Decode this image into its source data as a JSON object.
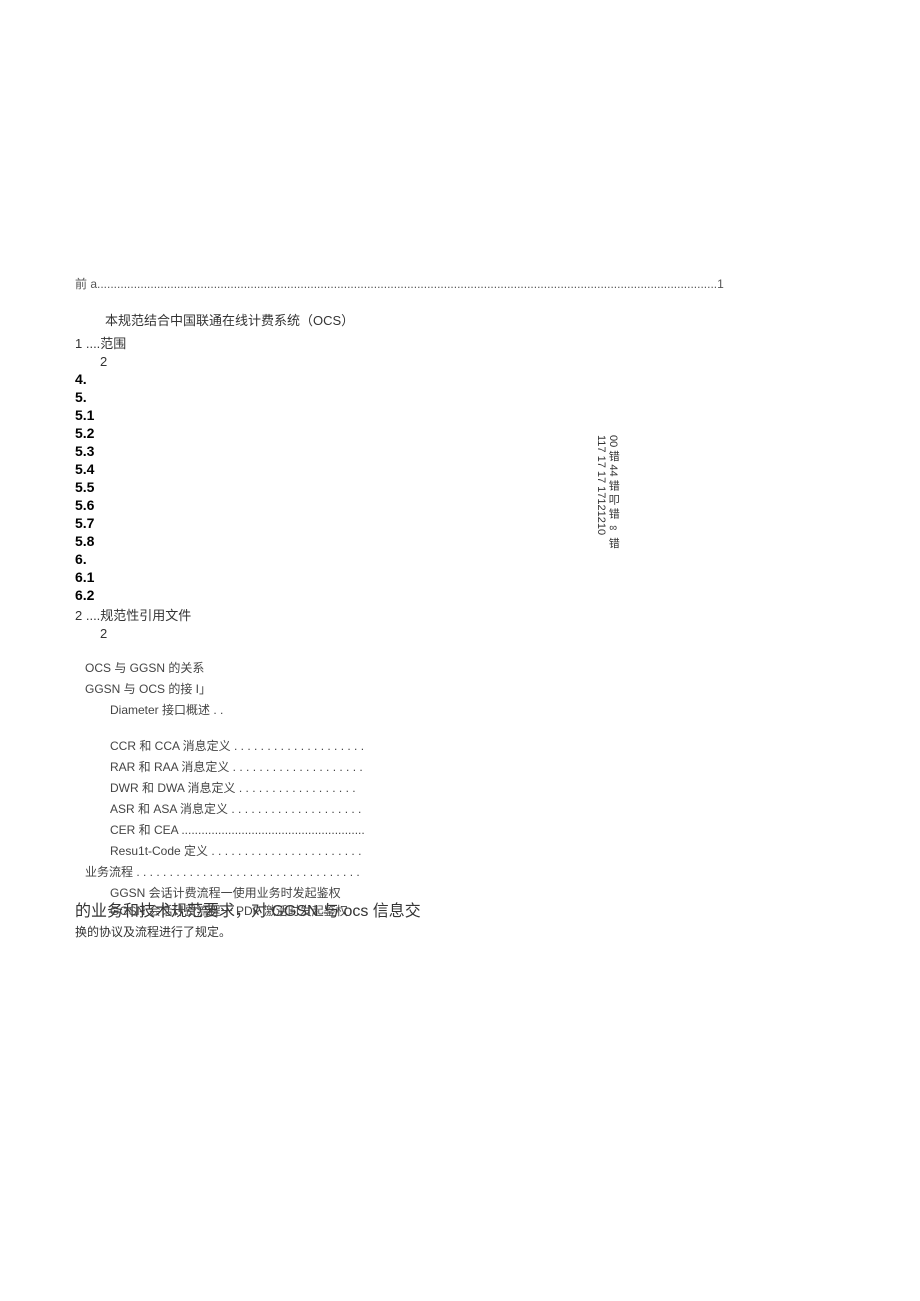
{
  "toc_header": {
    "prefix": "前 a",
    "dots": "..........................................................................................................................................................................................",
    "page": "1"
  },
  "intro_text": "本规范结合中国联通在线计费系统（OCS）",
  "items": [
    {
      "num": "1 ....",
      "text": "范围"
    },
    {
      "num": "",
      "text": "2",
      "indent": true
    }
  ],
  "bold_numbers": [
    "4.",
    "5.",
    "5.1",
    "5.2",
    "5.3",
    "5.4",
    "5.5",
    "5.6",
    "5.7",
    "5.8",
    "6.",
    "6.1",
    "6.2"
  ],
  "item_after": {
    "num": "2 ....",
    "text": "规范性引用文件",
    "val": "2"
  },
  "content_items": [
    {
      "text": "OCS 与 GGSN 的关系",
      "indent": "indent-1"
    },
    {
      "text": "GGSN 与 OCS 的接 I」",
      "indent": "indent-1"
    },
    {
      "text": "Diameter 接口概述 . .",
      "indent": "indent-2"
    }
  ],
  "message_items": [
    {
      "text": "CCR 和 CCA 消息定义 . . . . . . . . . . . . . . . . . . . .",
      "indent": "indent-3"
    },
    {
      "text": "RAR 和 RAA 消息定义 . . . . . . . . . . . . . . . . . . . .",
      "indent": "indent-3"
    },
    {
      "text": "DWR 和 DWA 消息定义 . . . . . . . . . . . . . . . . . .",
      "indent": "indent-3"
    },
    {
      "text": "ASR 和 ASA 消息定义 . . . . . . . . . . . . . . . . . . . .",
      "indent": "indent-3"
    },
    {
      "text": "CER 和 CEA .......................................................",
      "indent": "indent-3"
    },
    {
      "text": "Resu1t-Code 定义 . . . . . . . . . . . . . . . . . . . . . . .",
      "indent": "indent-3"
    }
  ],
  "business_items": [
    {
      "text": "业务流程 . . . . . . . . . . . . . . . . . . . . . . . . . . . . . . . . . .",
      "indent": "indent-0"
    },
    {
      "text": "GGSN 会话计费流程一使用业务时发起鉴权",
      "indent": "indent-3"
    }
  ],
  "mixed_overlap": "GGSN 会话计费流程一 PDP 激活时发起鉴权",
  "mixed_main": "的业务和技术规范要求，对 GGSN 与 ocs 信息交",
  "mixed_sub": "换的协议及流程进行了规定。",
  "vertical_text": {
    "line1": "00 错 44 错 叩",
    "line2": "错 ∞ 错",
    "line3": "117 17  17  17121210"
  }
}
